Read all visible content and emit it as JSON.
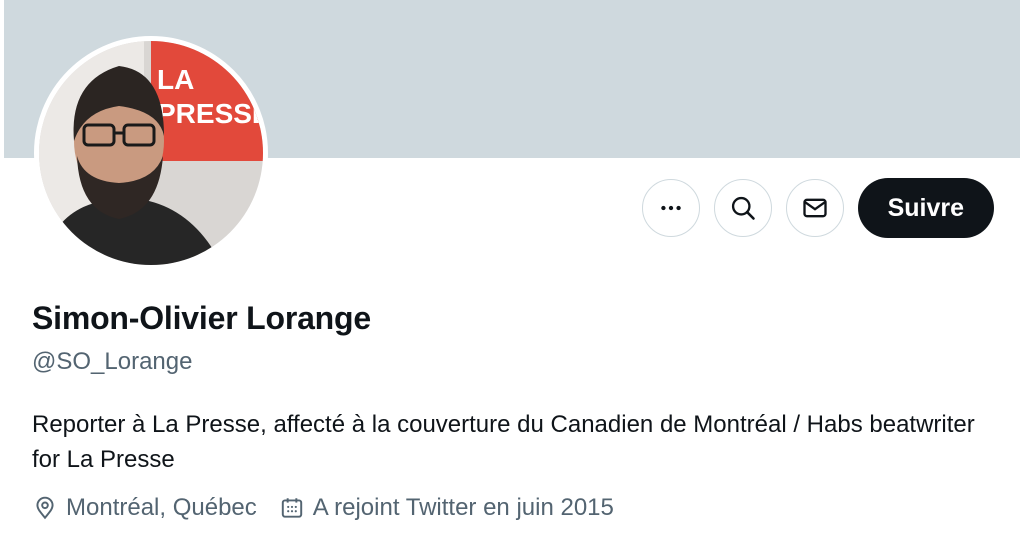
{
  "profile": {
    "display_name": "Simon-Olivier Lorange",
    "handle": "@SO_Lorange",
    "bio": "Reporter à La Presse, affecté à la couverture du Canadien de Montréal / Habs beatwriter for La Presse",
    "location": "Montréal, Québec",
    "joined": "A rejoint Twitter en juin 2015",
    "avatar_logo_text": [
      "LA",
      "PRESSE"
    ]
  },
  "actions": {
    "more_icon": "more-dots-icon",
    "search_icon": "search-icon",
    "message_icon": "mail-icon",
    "follow_label": "Suivre"
  },
  "colors": {
    "banner": "#cfd9de",
    "follow_button": "#0f1419",
    "secondary_text": "#536471",
    "logo_red": "#e2493b"
  }
}
